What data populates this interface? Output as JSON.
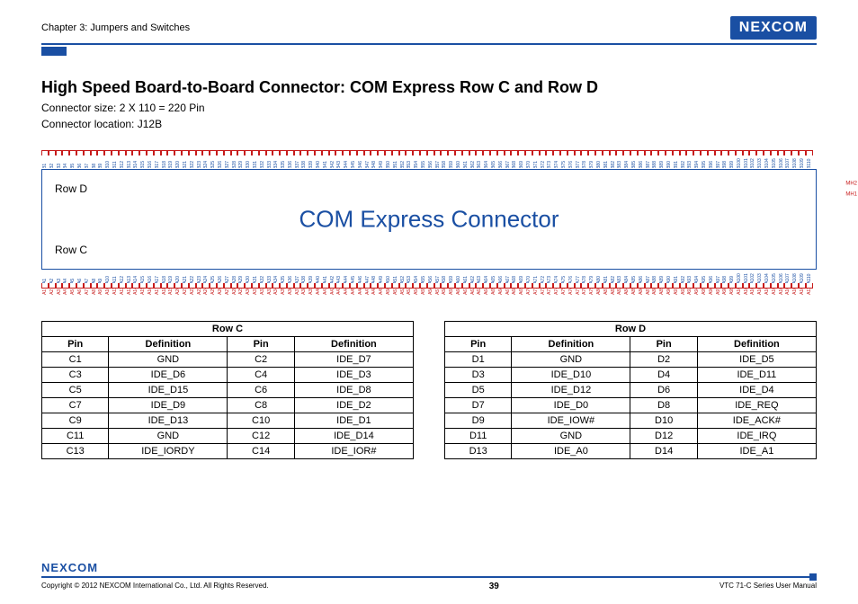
{
  "header": {
    "chapter": "Chapter 3: Jumpers and Switches",
    "brand": "NEXCOM"
  },
  "title": "High Speed Board-to-Board Connector: COM Express Row C and Row D",
  "sub1": "Connector size: 2 X 110 = 220 Pin",
  "sub2": "Connector location: J12B",
  "diagram": {
    "title": "COM Express Connector",
    "rowd": "Row D",
    "rowc": "Row C",
    "mh1": "MH1",
    "mh2": "MH2",
    "b_prefix": "B",
    "a_prefix": "A",
    "count": 110
  },
  "tables": {
    "rowc": {
      "caption": "Row C",
      "headers": [
        "Pin",
        "Definition",
        "Pin",
        "Definition"
      ],
      "rows": [
        [
          "C1",
          "GND",
          "C2",
          "IDE_D7"
        ],
        [
          "C3",
          "IDE_D6",
          "C4",
          "IDE_D3"
        ],
        [
          "C5",
          "IDE_D15",
          "C6",
          "IDE_D8"
        ],
        [
          "C7",
          "IDE_D9",
          "C8",
          "IDE_D2"
        ],
        [
          "C9",
          "IDE_D13",
          "C10",
          "IDE_D1"
        ],
        [
          "C11",
          "GND",
          "C12",
          "IDE_D14"
        ],
        [
          "C13",
          "IDE_IORDY",
          "C14",
          "IDE_IOR#"
        ]
      ]
    },
    "rowd": {
      "caption": "Row D",
      "headers": [
        "Pin",
        "Definition",
        "Pin",
        "Definition"
      ],
      "rows": [
        [
          "D1",
          "GND",
          "D2",
          "IDE_D5"
        ],
        [
          "D3",
          "IDE_D10",
          "D4",
          "IDE_D11"
        ],
        [
          "D5",
          "IDE_D12",
          "D6",
          "IDE_D4"
        ],
        [
          "D7",
          "IDE_D0",
          "D8",
          "IDE_REQ"
        ],
        [
          "D9",
          "IDE_IOW#",
          "D10",
          "IDE_ACK#"
        ],
        [
          "D11",
          "GND",
          "D12",
          "IDE_IRQ"
        ],
        [
          "D13",
          "IDE_A0",
          "D14",
          "IDE_A1"
        ]
      ]
    }
  },
  "footer": {
    "brand": "NEXCOM",
    "copyright": "Copyright © 2012 NEXCOM International Co., Ltd. All Rights Reserved.",
    "page": "39",
    "manual": "VTC 71-C Series User Manual"
  }
}
